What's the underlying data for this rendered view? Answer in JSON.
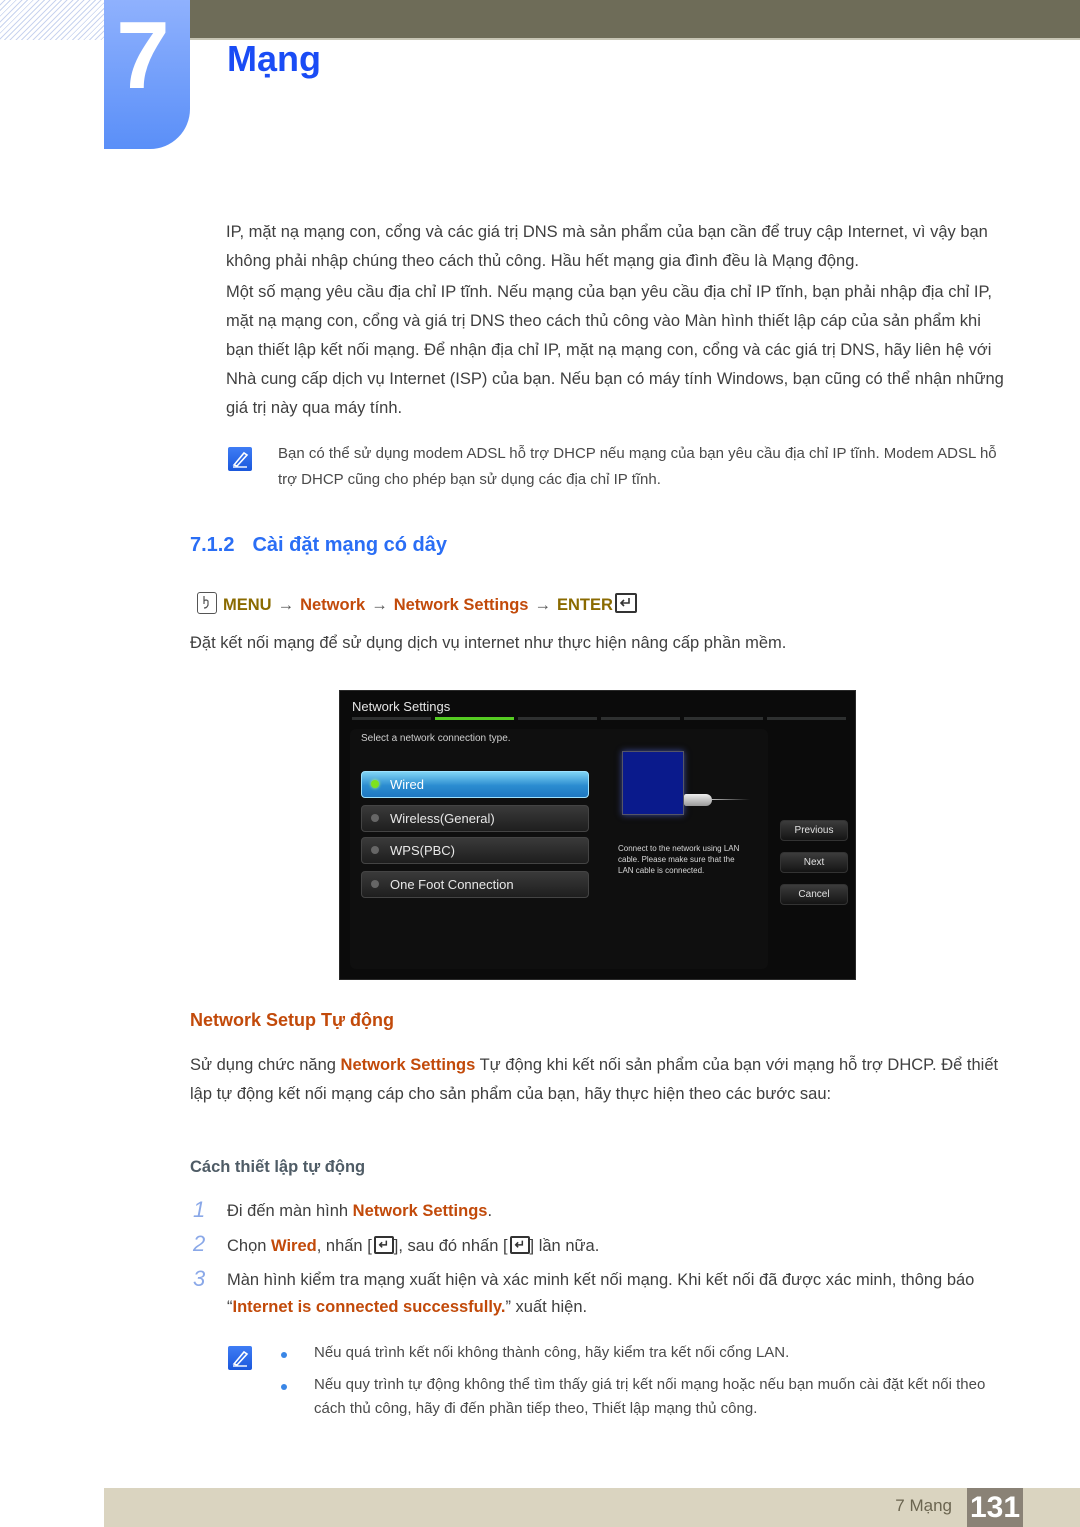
{
  "chapter": {
    "number": "7",
    "title": "Mạng"
  },
  "intro_paragraphs": [
    "IP, mặt nạ mạng con, cổng và các giá trị DNS mà sản phẩm của bạn cần để truy cập Internet, vì vậy bạn không phải nhập chúng theo cách thủ công. Hầu hết mạng gia đình đều là Mạng động.",
    "Một số mạng yêu cầu địa chỉ IP tĩnh. Nếu mạng của bạn yêu cầu địa chỉ IP tĩnh, bạn phải nhập địa chỉ IP, mặt nạ mạng con, cổng và giá trị DNS theo cách thủ công vào Màn hình thiết lập cáp của sản phẩm khi bạn thiết lập kết nối mạng. Để nhận địa chỉ IP, mặt nạ mạng con, cổng và các giá trị DNS, hãy liên hệ với Nhà cung cấp dịch vụ Internet (ISP) của bạn. Nếu bạn có máy tính Windows, bạn cũng có thể nhận những giá trị này qua máy tính."
  ],
  "note1": "Bạn có thể sử dụng modem ADSL hỗ trợ DHCP nếu mạng của bạn yêu cầu địa chỉ IP tĩnh. Modem ADSL hỗ trợ DHCP cũng cho phép bạn sử dụng các địa chỉ IP tĩnh.",
  "section": {
    "number": "7.1.2",
    "title": "Cài đặt mạng có dây"
  },
  "menu_path": {
    "menu": "MENU",
    "arrow": "→",
    "network": "Network",
    "network_settings": "Network Settings",
    "enter": "ENTER"
  },
  "section_desc": "Đặt kết nối mạng để sử dụng dịch vụ internet như thực hiện nâng cấp phần mềm.",
  "tv_screen": {
    "title": "Network Settings",
    "step_count": 6,
    "active_step": 2,
    "prompt": "Select a network connection type.",
    "options": [
      {
        "label": "Wired",
        "selected": true
      },
      {
        "label": "Wireless(General)",
        "selected": false
      },
      {
        "label": "WPS(PBC)",
        "selected": false
      },
      {
        "label": "One Foot Connection",
        "selected": false
      }
    ],
    "info": "Connect to the network using LAN cable. Please make sure that the LAN cable is connected.",
    "buttons": {
      "previous": "Previous",
      "next": "Next",
      "cancel": "Cancel"
    }
  },
  "auto_setup": {
    "heading": "Network Setup Tự động",
    "body_pre": "Sử dụng chức năng ",
    "body_hl": "Network Settings",
    "body_post": " Tự động khi kết nối sản phẩm của bạn với mạng hỗ trợ DHCP. Để thiết lập tự động kết nối mạng cáp cho sản phẩm của bạn, hãy thực hiện theo các bước sau:",
    "subheading": "Cách thiết lập tự động",
    "steps": [
      {
        "num": "1",
        "pre": "Đi đến màn hình ",
        "hl": "Network Settings",
        "post": "."
      },
      {
        "num": "2",
        "pre": "Chọn ",
        "hl": "Wired",
        "mid": ", nhấn [",
        "mid2": "], sau đó nhấn [",
        "post": "] lần nữa."
      },
      {
        "num": "3",
        "pre": "Màn hình kiểm tra mạng xuất hiện và xác minh kết nối mạng. Khi kết nối đã được xác minh, thông báo “",
        "hl": "Internet is connected successfully.",
        "post": "” xuất hiện."
      }
    ],
    "notes": [
      "Nếu quá trình kết nối không thành công, hãy kiểm tra kết nối cổng LAN.",
      "Nếu quy trình tự động không thể tìm thấy giá trị kết nối mạng hoặc nếu bạn muốn cài đặt kết nối theo cách thủ công, hãy đi đến phần tiếp theo, Thiết lập mạng thủ công."
    ]
  },
  "footer": {
    "label": "7 Mạng",
    "page": "131"
  },
  "colors": {
    "chapter_blue": "#1a4cf5",
    "highlight_orange": "#c24a0a",
    "menu_gold": "#8a6a00",
    "selected_green": "#7ee21e"
  }
}
